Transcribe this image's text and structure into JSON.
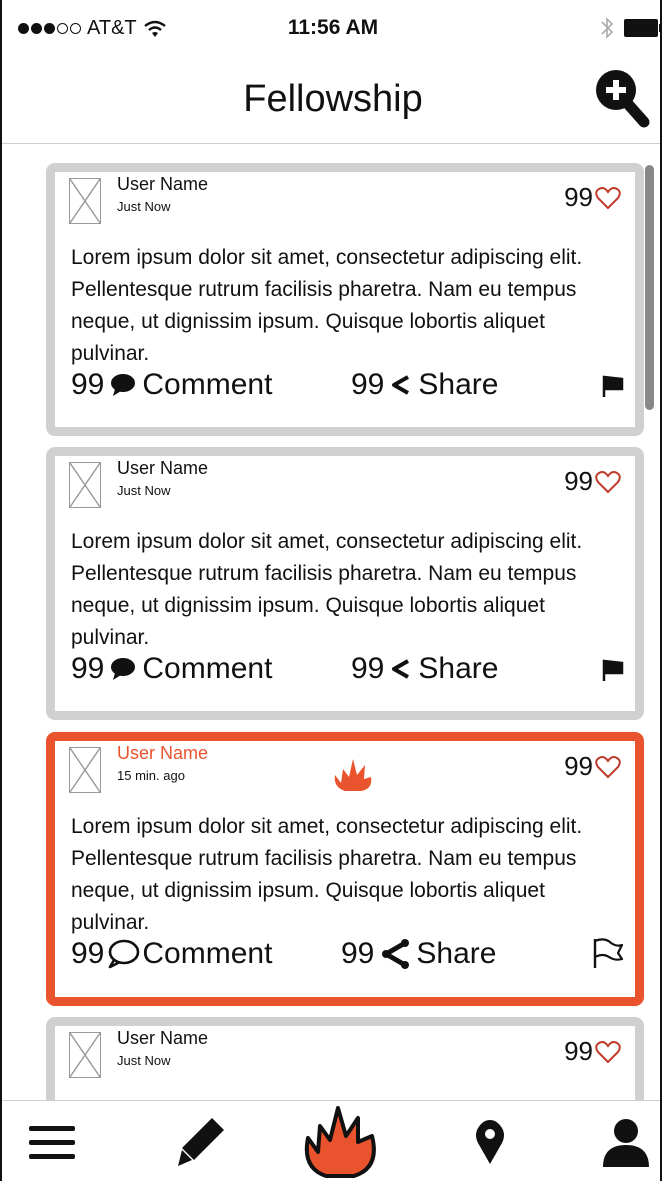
{
  "status_bar": {
    "carrier": "AT&T",
    "time": "11:56 AM"
  },
  "header": {
    "title": "Fellowship",
    "add_icon": "search-plus-icon"
  },
  "posts": [
    {
      "user_name": "User Name",
      "time": "Just Now",
      "likes": "99",
      "text": "Lorem ipsum dolor sit amet, consectetur adipiscing elit. Pellentesque rutrum facilisis pharetra. Nam eu tempus neque, ut dignissim ipsum. Quisque lobortis aliquet pulvinar.",
      "comments": "99",
      "comment_label": "Comment",
      "shares": "99",
      "share_label": "Share",
      "hot": false
    },
    {
      "user_name": "User Name",
      "time": "Just Now",
      "likes": "99",
      "text": "Lorem ipsum dolor sit amet, consectetur adipiscing elit. Pellentesque rutrum facilisis pharetra. Nam eu tempus neque, ut dignissim ipsum. Quisque lobortis aliquet pulvinar.",
      "comments": "99",
      "comment_label": "Comment",
      "shares": "99",
      "share_label": "Share",
      "hot": false
    },
    {
      "user_name": "User Name",
      "time": "15 min. ago",
      "likes": "99",
      "text": "Lorem ipsum dolor sit amet, consectetur adipiscing elit. Pellentesque rutrum facilisis pharetra. Nam eu tempus neque, ut dignissim ipsum. Quisque lobortis aliquet pulvinar.",
      "comments": "99",
      "comment_label": "Comment",
      "shares": "99",
      "share_label": "Share",
      "hot": true
    },
    {
      "user_name": "User Name",
      "time": "Just Now",
      "likes": "99"
    }
  ],
  "tab_bar": [
    "menu-icon",
    "compose-icon",
    "fire-icon",
    "location-icon",
    "profile-icon"
  ],
  "colors": {
    "accent": "#e9532e",
    "heart": "#c0392b",
    "card_border": "#d0d0d0"
  }
}
